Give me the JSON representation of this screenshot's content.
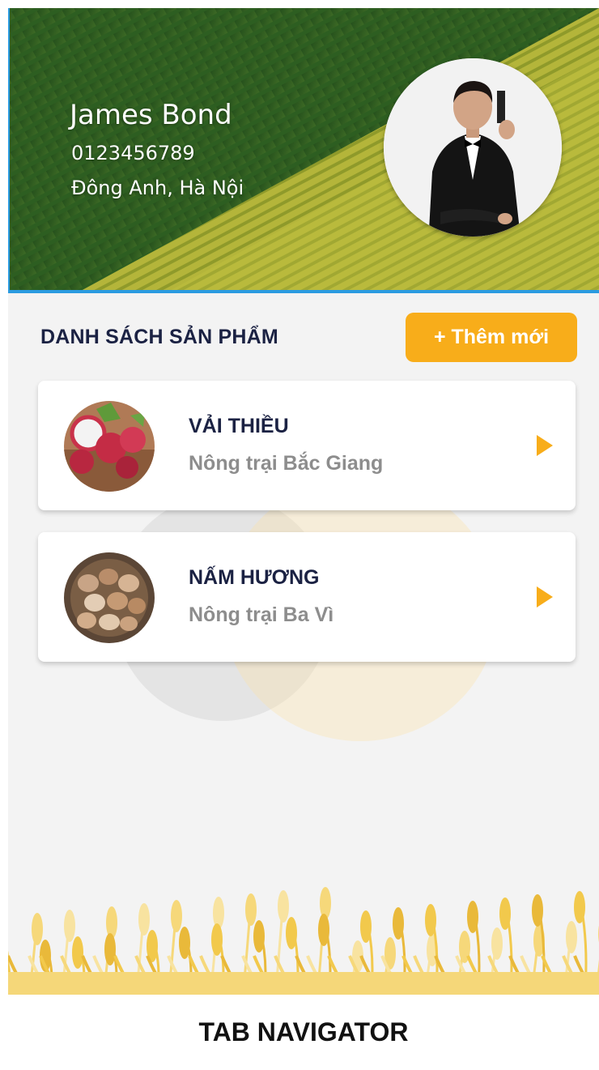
{
  "profile": {
    "name": "James Bond",
    "phone": "0123456789",
    "address": "Đông Anh, Hà Nội"
  },
  "products_section": {
    "title": "DANH SÁCH SẢN PHẨM",
    "add_button_label": "+ Thêm mới"
  },
  "products": [
    {
      "name": "VẢI THIỀU",
      "farm": "Nông trại Bắc Giang",
      "thumb_icon": "lychee-photo",
      "chevron_icon": "play-arrow-icon"
    },
    {
      "name": "NẤM HƯƠNG",
      "farm": "Nông trại Ba Vì",
      "thumb_icon": "mushroom-photo",
      "chevron_icon": "play-arrow-icon"
    }
  ],
  "tab_navigator": {
    "label": "TAB NAVIGATOR"
  },
  "colors": {
    "accent": "#f8ad1a",
    "header_border": "#2b9be0",
    "title_text": "#1b2243",
    "subtitle_text": "#8d8d8d"
  }
}
